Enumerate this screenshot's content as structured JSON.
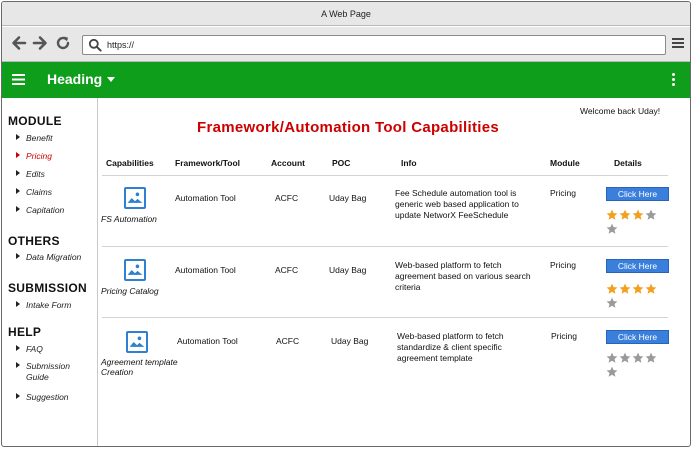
{
  "window": {
    "title": "A Web Page"
  },
  "browser": {
    "url": "https://"
  },
  "appbar": {
    "heading": "Heading"
  },
  "sidebar": {
    "sections": [
      {
        "title": "MODULE",
        "items": [
          {
            "label": "Benefit",
            "active": false
          },
          {
            "label": "Pricing",
            "active": true
          },
          {
            "label": "Edits",
            "active": false
          },
          {
            "label": "Claims",
            "active": false
          },
          {
            "label": "Capitation",
            "active": false
          }
        ]
      },
      {
        "title": "OTHERS",
        "items": [
          {
            "label": "Data Migration",
            "active": false
          }
        ]
      },
      {
        "title": "SUBMISSION",
        "items": [
          {
            "label": "Intake Form",
            "active": false
          }
        ]
      },
      {
        "title": "HELP",
        "items": [
          {
            "label": "FAQ",
            "active": false
          },
          {
            "label": "Submission Guide",
            "active": false
          },
          {
            "label": "Suggestion",
            "active": false
          }
        ]
      }
    ]
  },
  "main": {
    "welcome": "Welcome back Uday!",
    "title": "Framework/Automation Tool Capabilities",
    "columns": [
      "Capabilities",
      "Framework/Tool",
      "Account",
      "POC",
      "Info",
      "Module",
      "Details"
    ],
    "rows": [
      {
        "capability": "FS Automation",
        "tool": "Automation Tool",
        "account": "ACFC",
        "poc": "Uday Bag",
        "info": "Fee Schedule automation tool is generic web based application to update NetworX FeeSchedule",
        "module": "Pricing",
        "button": "Click Here",
        "rating": 3
      },
      {
        "capability": "Pricing Catalog",
        "tool": "Automation Tool",
        "account": "ACFC",
        "poc": "Uday Bag",
        "info": "Web-based platform to fetch agreement based on various search criteria",
        "module": "Pricing",
        "button": "Click Here",
        "rating": 4
      },
      {
        "capability": "Agreement template Creation",
        "tool": "Automation Tool",
        "account": "ACFC",
        "poc": "Uday Bag",
        "info": "Web-based platform to fetch standardize & client specific agreement template",
        "module": "Pricing",
        "button": "Click Here",
        "rating": 0
      }
    ],
    "rating_max": 5
  },
  "colors": {
    "appbar": "#0f9d1c",
    "title": "#cc0000",
    "active_nav": "#cc0000",
    "button": "#3a7fdb",
    "star_filled": "#f2a01e",
    "star_empty": "#9a9a9a",
    "image_icon": "#2f7fd2"
  },
  "icons": [
    "back-arrow-icon",
    "forward-arrow-icon",
    "refresh-icon",
    "search-icon",
    "browser-menu-icon",
    "hamburger-icon",
    "caret-down-icon",
    "kebab-menu-icon",
    "image-placeholder-icon",
    "star-icon"
  ]
}
